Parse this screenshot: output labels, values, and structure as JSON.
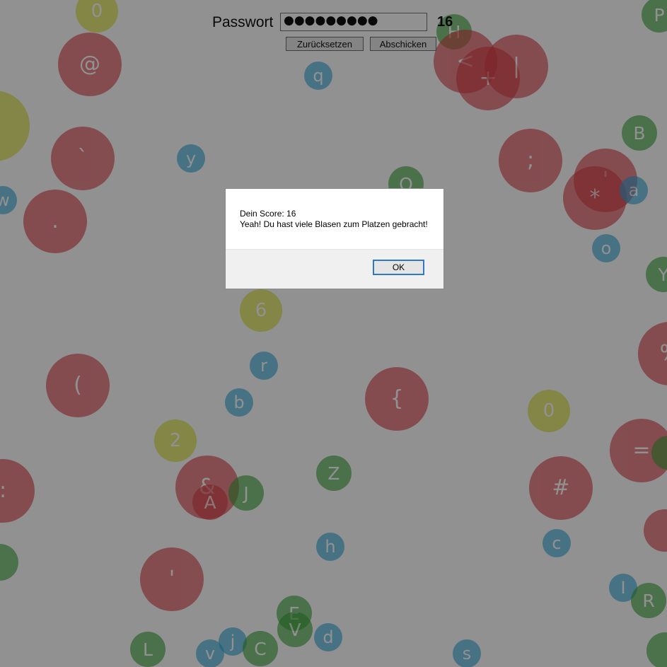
{
  "form": {
    "password_label": "Passwort",
    "password_value": "●●●●●●●●●",
    "score": "16",
    "reset_label": "Zurücksetzen",
    "submit_label": "Abschicken"
  },
  "dialog": {
    "score_line": "Dein Score: 16",
    "message": "Yeah! Du hast viele Blasen zum Platzen gebracht!",
    "ok_label": "OK"
  },
  "bubble_colors": {
    "red": "#dc3f47",
    "green": "#39a639",
    "blue": "#2ea7dd",
    "yellow": "#d7e12a",
    "overlay": "rgba(0,0,0,0.43)"
  },
  "bubbles": [
    {
      "char": "0",
      "color": "yellow",
      "size": "mid"
    },
    {
      "char": "@",
      "color": "red",
      "size": "big"
    },
    {
      "char": "H",
      "color": "green",
      "size": "small"
    },
    {
      "char": "<",
      "color": "red",
      "size": "big"
    },
    {
      "char": "+",
      "color": "red",
      "size": "big"
    },
    {
      "char": "|",
      "color": "red",
      "size": "big"
    },
    {
      "char": "q",
      "color": "blue",
      "size": "tiny"
    },
    {
      "char": "P",
      "color": "green",
      "size": "small"
    },
    {
      "char": "B",
      "color": "green",
      "size": "small"
    },
    {
      "char": "`",
      "color": "red",
      "size": "big"
    },
    {
      "char": "y",
      "color": "blue",
      "size": "tiny"
    },
    {
      "char": ";",
      "color": "red",
      "size": "big"
    },
    {
      "char": "'",
      "color": "red",
      "size": "big"
    },
    {
      "char": "*",
      "color": "red",
      "size": "big"
    },
    {
      "char": "a",
      "color": "blue",
      "size": "tiny"
    },
    {
      "char": "O",
      "color": "green",
      "size": "small"
    },
    {
      "char": "w",
      "color": "blue",
      "size": "tiny"
    },
    {
      "char": ".",
      "color": "red",
      "size": "big"
    },
    {
      "char": "o",
      "color": "blue",
      "size": "tiny"
    },
    {
      "char": "Y",
      "color": "green",
      "size": "small"
    },
    {
      "char": "6",
      "color": "yellow",
      "size": "mid"
    },
    {
      "char": "r",
      "color": "blue",
      "size": "tiny"
    },
    {
      "char": "%",
      "color": "red",
      "size": "big"
    },
    {
      "char": "(",
      "color": "red",
      "size": "big"
    },
    {
      "char": "{",
      "color": "red",
      "size": "big"
    },
    {
      "char": "b",
      "color": "blue",
      "size": "tiny"
    },
    {
      "char": "0",
      "color": "yellow",
      "size": "mid"
    },
    {
      "char": "2",
      "color": "yellow",
      "size": "mid"
    },
    {
      "char": "=",
      "color": "red",
      "size": "big"
    },
    {
      "char": "Z",
      "color": "green",
      "size": "small"
    },
    {
      "char": ":",
      "color": "red",
      "size": "big"
    },
    {
      "char": "&",
      "color": "red",
      "size": "big"
    },
    {
      "char": "A",
      "color": "red",
      "size": "small"
    },
    {
      "char": "J",
      "color": "green",
      "size": "small"
    },
    {
      "char": "#",
      "color": "red",
      "size": "big"
    },
    {
      "char": "h",
      "color": "blue",
      "size": "tiny"
    },
    {
      "char": "c",
      "color": "blue",
      "size": "tiny"
    },
    {
      "char": "'",
      "color": "red",
      "size": "big"
    },
    {
      "char": "I",
      "color": "blue",
      "size": "tiny"
    },
    {
      "char": "R",
      "color": "green",
      "size": "small"
    },
    {
      "char": "E",
      "color": "green",
      "size": "small"
    },
    {
      "char": "V",
      "color": "green",
      "size": "small"
    },
    {
      "char": "j",
      "color": "blue",
      "size": "tiny"
    },
    {
      "char": "d",
      "color": "blue",
      "size": "tiny"
    },
    {
      "char": "L",
      "color": "green",
      "size": "small"
    },
    {
      "char": "v",
      "color": "blue",
      "size": "tiny"
    },
    {
      "char": "C",
      "color": "green",
      "size": "small"
    },
    {
      "char": "s",
      "color": "blue",
      "size": "tiny"
    }
  ]
}
